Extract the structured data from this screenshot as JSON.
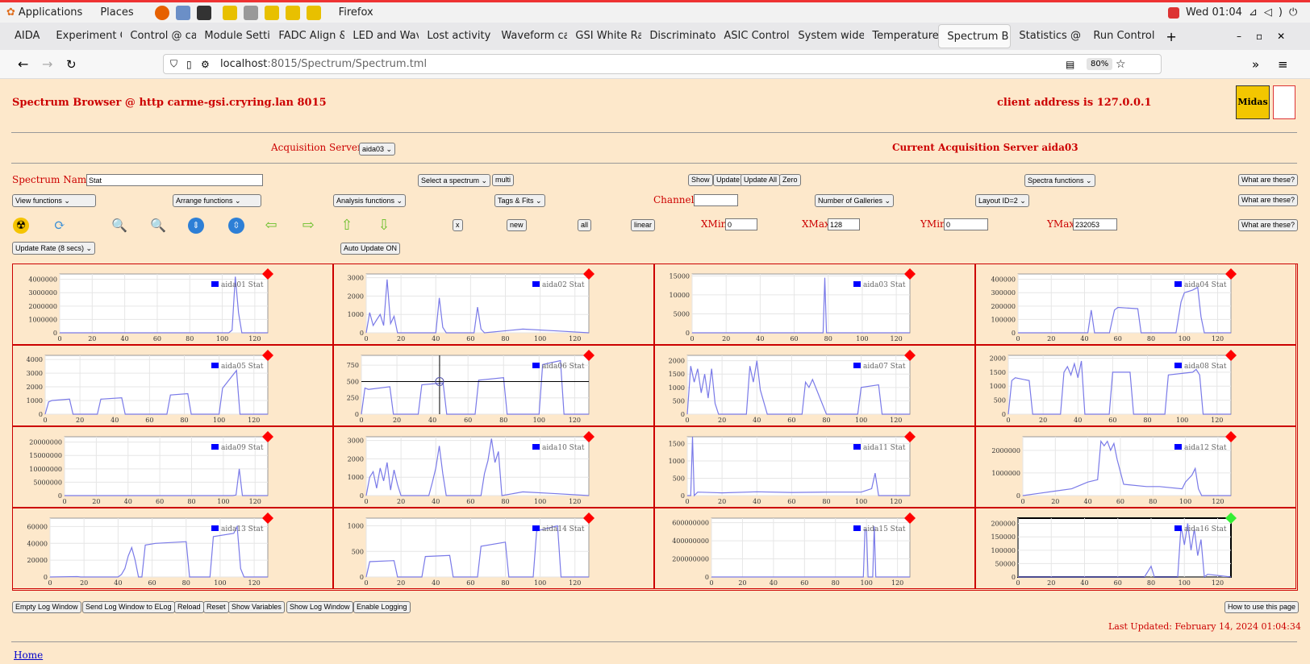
{
  "topbar": {
    "applications": "Applications",
    "places": "Places",
    "firefox": "Firefox",
    "clock": "Wed 01:04"
  },
  "tabs": [
    "AIDA",
    "Experiment C",
    "Control @ ca",
    "Module Setti",
    "FADC Align &",
    "LED and Wav",
    "Lost activity",
    "Waveform ca",
    "GSI White Ra",
    "Discriminator",
    "ASIC Control",
    "System wide",
    "Temperature",
    "Spectrum B",
    "Statistics @",
    "Run Control"
  ],
  "url": {
    "host": "localhost",
    "path": ":8015/Spectrum/Spectrum.tml",
    "zoom": "80%"
  },
  "page": {
    "title": "Spectrum Browser @ http carme-gsi.cryring.lan 8015",
    "client": "client address is 127.0.0.1",
    "acq_label": "Acquisition Servers",
    "acq_value": "aida03",
    "current": "Current Acquisition Server aida03",
    "spectrum_name_label": "Spectrum Name:",
    "spectrum_name": "Stat",
    "select_spectrum": "Select a spectrum",
    "multi": "multi",
    "show": "Show",
    "update": "Update",
    "update_all": "Update All",
    "zero": "Zero",
    "spectra_functions": "Spectra functions",
    "what": "What are these?",
    "view_functions": "View functions",
    "arrange_functions": "Arrange functions",
    "analysis_functions": "Analysis functions",
    "tags_fits": "Tags & Fits",
    "channel_label": "Channel:",
    "galleries": "Number of Galleries",
    "layout": "Layout ID=2",
    "x": "x",
    "new": "new",
    "all": "all",
    "linear": "linear",
    "xmin_label": "XMin",
    "xmin": "0",
    "xmax_label": "XMax",
    "xmax": "128",
    "ymin_label": "YMin",
    "ymin": "0",
    "ymax_label": "YMax",
    "ymax": "232053",
    "update_rate": "Update Rate (8 secs)",
    "auto_update": "Auto Update ON",
    "empty_log": "Empty Log Window",
    "send_log": "Send Log Window to ELog",
    "reload": "Reload",
    "reset": "Reset",
    "show_vars": "Show Variables",
    "show_log": "Show Log Window",
    "enable_logging": "Enable Logging",
    "howto": "How to use this page",
    "last_updated": "Last Updated: February 14, 2024 01:04:34",
    "home": "Home"
  },
  "chart_data": [
    {
      "type": "line",
      "name": "aida01 Stat",
      "yticks": [
        "4000000",
        "3000000",
        "2000000",
        "1000000",
        "0"
      ],
      "ylim": [
        0,
        4400000
      ],
      "x": [
        0,
        104,
        106,
        108,
        110,
        112,
        128
      ],
      "values": [
        0,
        0,
        200000,
        4200000,
        1500000,
        0,
        0
      ],
      "status": "red"
    },
    {
      "type": "line",
      "name": "aida02 Stat",
      "yticks": [
        "3000",
        "2000",
        "1000",
        "0"
      ],
      "ylim": [
        0,
        3200
      ],
      "x": [
        0,
        2,
        4,
        6,
        8,
        10,
        12,
        14,
        16,
        18,
        40,
        42,
        44,
        46,
        62,
        64,
        66,
        68,
        90,
        110,
        128
      ],
      "values": [
        0,
        1100,
        400,
        700,
        1000,
        400,
        2900,
        500,
        900,
        0,
        0,
        1900,
        300,
        0,
        0,
        1400,
        200,
        0,
        200,
        100,
        0
      ],
      "status": "red"
    },
    {
      "type": "line",
      "name": "aida03 Stat",
      "yticks": [
        "15000",
        "10000",
        "5000",
        "0"
      ],
      "ylim": [
        0,
        15500
      ],
      "x": [
        0,
        76,
        77,
        78,
        79,
        128
      ],
      "values": [
        0,
        0,
        0,
        14500,
        0,
        0
      ],
      "status": "red"
    },
    {
      "type": "line",
      "name": "aida04 Stat",
      "yticks": [
        "400000",
        "300000",
        "200000",
        "100000",
        "0"
      ],
      "ylim": [
        0,
        440000
      ],
      "x": [
        0,
        42,
        44,
        46,
        55,
        58,
        60,
        72,
        74,
        76,
        95,
        98,
        100,
        105,
        108,
        110,
        112,
        114,
        128
      ],
      "values": [
        0,
        0,
        170000,
        0,
        0,
        170000,
        190000,
        180000,
        0,
        0,
        0,
        230000,
        300000,
        320000,
        340000,
        120000,
        0,
        0,
        0
      ],
      "status": "red"
    },
    {
      "type": "line",
      "name": "aida05 Stat",
      "yticks": [
        "4000",
        "3000",
        "2000",
        "1000",
        "0"
      ],
      "ylim": [
        0,
        4300
      ],
      "x": [
        0,
        2,
        4,
        14,
        16,
        30,
        32,
        44,
        46,
        70,
        72,
        82,
        84,
        100,
        102,
        110,
        112,
        128
      ],
      "values": [
        0,
        900,
        1000,
        1100,
        0,
        0,
        1100,
        1200,
        0,
        0,
        1400,
        1500,
        0,
        0,
        1900,
        3200,
        0,
        0
      ],
      "status": "red"
    },
    {
      "type": "line",
      "name": "aida06 Stat",
      "yticks": [
        "750",
        "500",
        "250",
        "0"
      ],
      "ylim": [
        0,
        900
      ],
      "x": [
        0,
        2,
        4,
        16,
        18,
        32,
        34,
        46,
        48,
        64,
        66,
        80,
        82,
        100,
        102,
        112,
        114,
        128
      ],
      "values": [
        0,
        400,
        380,
        420,
        0,
        0,
        450,
        480,
        0,
        0,
        520,
        560,
        0,
        0,
        760,
        820,
        0,
        0
      ],
      "status": "red",
      "crosshair": true
    },
    {
      "type": "line",
      "name": "aida07 Stat",
      "yticks": [
        "2000",
        "1500",
        "1000",
        "500",
        "0"
      ],
      "ylim": [
        0,
        2200
      ],
      "x": [
        0,
        2,
        4,
        6,
        8,
        10,
        12,
        14,
        16,
        18,
        34,
        36,
        38,
        40,
        42,
        46,
        66,
        68,
        70,
        72,
        80,
        82,
        98,
        100,
        110,
        112,
        128
      ],
      "values": [
        0,
        1800,
        1200,
        1700,
        800,
        1500,
        600,
        1700,
        400,
        0,
        0,
        1800,
        1200,
        2000,
        900,
        0,
        0,
        1200,
        1000,
        1300,
        0,
        0,
        0,
        1000,
        1100,
        0,
        0
      ],
      "status": "red"
    },
    {
      "type": "line",
      "name": "aida08 Stat",
      "yticks": [
        "2000",
        "1500",
        "1000",
        "500",
        "0"
      ],
      "ylim": [
        0,
        2100
      ],
      "x": [
        0,
        2,
        4,
        12,
        14,
        30,
        32,
        34,
        36,
        38,
        40,
        42,
        44,
        58,
        60,
        70,
        72,
        90,
        92,
        106,
        108,
        110,
        112,
        128
      ],
      "values": [
        0,
        1200,
        1300,
        1200,
        0,
        0,
        1500,
        1700,
        1400,
        1800,
        1300,
        1900,
        0,
        0,
        1500,
        1500,
        0,
        0,
        1400,
        1500,
        1600,
        1400,
        0,
        0
      ],
      "status": "red"
    },
    {
      "type": "line",
      "name": "aida09 Stat",
      "yticks": [
        "20000000",
        "15000000",
        "10000000",
        "5000000",
        "0"
      ],
      "ylim": [
        0,
        22000000
      ],
      "x": [
        0,
        106,
        108,
        110,
        112,
        128
      ],
      "values": [
        0,
        0,
        200000,
        10000000,
        0,
        0
      ],
      "status": "red"
    },
    {
      "type": "line",
      "name": "aida10 Stat",
      "yticks": [
        "3000",
        "2000",
        "1000",
        "0"
      ],
      "ylim": [
        0,
        3200
      ],
      "x": [
        0,
        2,
        4,
        6,
        8,
        10,
        12,
        14,
        16,
        18,
        20,
        36,
        38,
        40,
        42,
        44,
        46,
        66,
        68,
        70,
        72,
        74,
        76,
        78,
        90,
        110,
        128
      ],
      "values": [
        0,
        1000,
        1300,
        400,
        1500,
        800,
        1800,
        300,
        1400,
        600,
        0,
        0,
        700,
        1500,
        2700,
        1200,
        0,
        0,
        1200,
        1900,
        3100,
        1800,
        2400,
        0,
        200,
        100,
        0
      ],
      "status": "red"
    },
    {
      "type": "line",
      "name": "aida11 Stat",
      "yticks": [
        "1500",
        "1000",
        "500",
        "0"
      ],
      "ylim": [
        0,
        1700
      ],
      "x": [
        0,
        2,
        3,
        4,
        6,
        20,
        40,
        60,
        80,
        100,
        106,
        108,
        110,
        128
      ],
      "values": [
        0,
        0,
        1700,
        0,
        100,
        80,
        110,
        90,
        100,
        100,
        200,
        650,
        0,
        0
      ],
      "status": "red"
    },
    {
      "type": "line",
      "name": "aida12 Stat",
      "yticks": [
        "2000000",
        "1000000",
        "0"
      ],
      "ylim": [
        0,
        2600000
      ],
      "x": [
        0,
        10,
        20,
        30,
        40,
        46,
        48,
        50,
        52,
        54,
        56,
        58,
        62,
        76,
        84,
        98,
        100,
        104,
        106,
        108,
        110,
        128
      ],
      "values": [
        0,
        100000,
        200000,
        300000,
        600000,
        700000,
        2400000,
        2200000,
        2400000,
        2000000,
        2300000,
        1600000,
        500000,
        400000,
        400000,
        300000,
        600000,
        900000,
        1200000,
        300000,
        0,
        0
      ],
      "status": "red"
    },
    {
      "type": "line",
      "name": "aida13 Stat",
      "yticks": [
        "60000",
        "40000",
        "20000",
        "0"
      ],
      "ylim": [
        0,
        70000
      ],
      "x": [
        0,
        16,
        18,
        40,
        42,
        44,
        46,
        48,
        50,
        52,
        54,
        56,
        62,
        80,
        82,
        94,
        96,
        108,
        110,
        112,
        114,
        128
      ],
      "values": [
        0,
        500,
        0,
        0,
        3000,
        10000,
        25000,
        35000,
        20000,
        0,
        0,
        38000,
        40000,
        42000,
        0,
        0,
        48000,
        52000,
        60000,
        10000,
        0,
        0
      ],
      "status": "red"
    },
    {
      "type": "line",
      "name": "aida14 Stat",
      "yticks": [
        "1000",
        "500",
        "0"
      ],
      "ylim": [
        0,
        1150
      ],
      "x": [
        0,
        2,
        16,
        18,
        32,
        34,
        48,
        50,
        64,
        66,
        80,
        82,
        96,
        98,
        110,
        112,
        128
      ],
      "values": [
        0,
        300,
        320,
        0,
        0,
        400,
        420,
        0,
        0,
        600,
        680,
        0,
        0,
        900,
        1000,
        0,
        0
      ],
      "status": "red"
    },
    {
      "type": "line",
      "name": "aida15 Stat",
      "yticks": [
        "600000000",
        "400000000",
        "200000000",
        "0"
      ],
      "ylim": [
        0,
        650000000
      ],
      "x": [
        0,
        98,
        99,
        100,
        101,
        102,
        104,
        105,
        106,
        128
      ],
      "values": [
        0,
        0,
        520000000,
        520000000,
        0,
        0,
        0,
        560000000,
        0,
        0
      ],
      "status": "red"
    },
    {
      "type": "line",
      "name": "aida16 Stat",
      "yticks": [
        "200000",
        "150000",
        "100000",
        "50000",
        "0"
      ],
      "ylim": [
        0,
        220000
      ],
      "x": [
        0,
        76,
        78,
        80,
        82,
        96,
        98,
        100,
        102,
        104,
        106,
        108,
        110,
        112,
        114,
        128
      ],
      "values": [
        0,
        0,
        20000,
        40000,
        0,
        0,
        190000,
        120000,
        200000,
        100000,
        180000,
        80000,
        140000,
        0,
        10000,
        0
      ],
      "status": "green",
      "selected": true
    }
  ]
}
